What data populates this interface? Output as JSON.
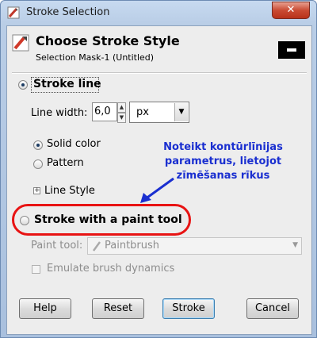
{
  "window": {
    "title": "Stroke Selection",
    "close_glyph": "✕",
    "icon": "stroke-selection-icon"
  },
  "header": {
    "title": "Choose Stroke Style",
    "subtitle": "Selection Mask-1 (Untitled)",
    "icon": "paint-brush-icon"
  },
  "stroke_line": {
    "label": "Stroke line",
    "selected": true,
    "line_width_label": "Line width:",
    "line_width_value": "6,0",
    "unit_value": "px",
    "fill_options": [
      {
        "label": "Solid color",
        "selected": true
      },
      {
        "label": "Pattern",
        "selected": false
      }
    ],
    "line_style_label": "Line Style"
  },
  "stroke_paint": {
    "label": "Stroke with a paint tool",
    "selected": false,
    "paint_tool_label": "Paint tool:",
    "paint_tool_value": "Paintbrush",
    "emulate_label": "Emulate brush dynamics",
    "emulate_checked": false
  },
  "buttons": {
    "help": "Help",
    "reset": "Reset",
    "stroke": "Stroke",
    "cancel": "Cancel"
  },
  "annotation": {
    "text": "Noteikt kontūrlīnijas parametrus, lietojot zīmēšanas rīkus",
    "color": "#1a2fd0"
  },
  "colors": {
    "highlight_oval": "#e81313",
    "annotation_arrow": "#1a2fd0"
  }
}
